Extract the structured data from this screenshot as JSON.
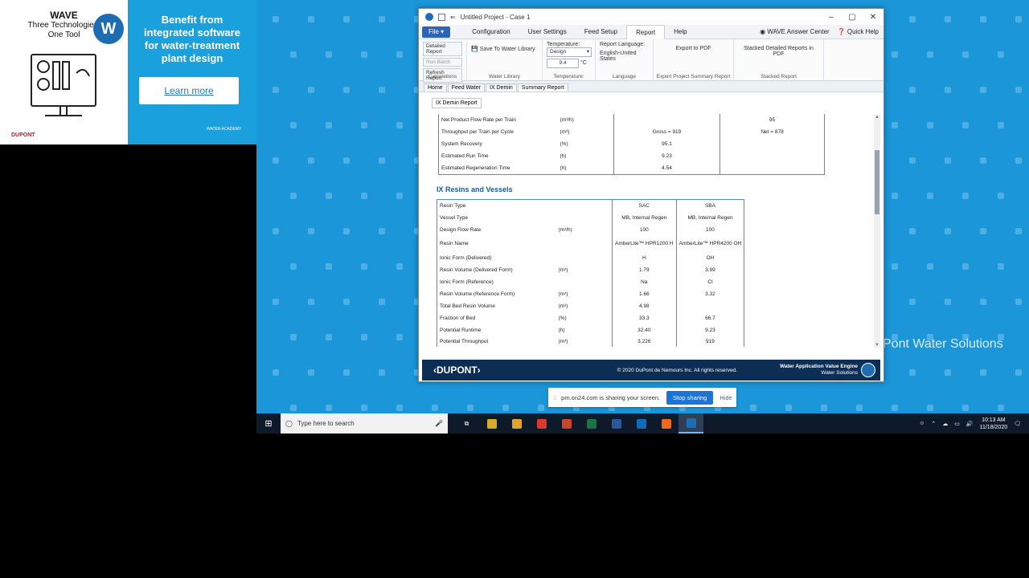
{
  "promo": {
    "product": "WAVE",
    "tagline_1": "Three Technologies,",
    "tagline_2": "One Tool",
    "logo_letter": "W",
    "brand": "DUPONT",
    "headline": "Benefit from integrated software for water-treatment plant design",
    "cta": "Learn more",
    "academy": "WATER ACADEMY"
  },
  "window": {
    "title": "Untitled Project - Case 1",
    "controls": [
      "–",
      "▢",
      "✕"
    ]
  },
  "menu": {
    "file": "File ▾",
    "items": [
      "Configuration",
      "User Settings",
      "Feed Setup",
      "Report",
      "Help"
    ],
    "active": "Report",
    "answer_center": "WAVE Answer Center",
    "quick_help": "Quick Help"
  },
  "ribbon": {
    "calc_buttons": [
      "Detailed Report",
      "Run Batch",
      "Refresh Report"
    ],
    "calc_caption": "Calculations",
    "save_water": "Save To Water Library",
    "water_caption": "Water Library",
    "temp_label": "Temperature:",
    "temp_select": "Design",
    "temp_value": "9.4",
    "temp_unit": "°C",
    "temp_caption": "Temperature:",
    "lang_label": "Report Language:",
    "lang_value": "English-United States",
    "lang_caption": "Language",
    "export_pdf": "Export to PDF",
    "export_caption": "Export Project Summary Report",
    "stacked": "Stacked Detailed Reports in PDF",
    "stacked_caption": "Stacked Report"
  },
  "tabs": [
    "Home",
    "Feed Water",
    "IX Demin",
    "Summary Report"
  ],
  "active_tab": "Summary Report",
  "subtab": "IX Demin Report",
  "summary_rows": [
    {
      "label": "Net Product Flow Rate per Train",
      "unit": "(m³/h)",
      "v1": "",
      "v2": "95"
    },
    {
      "label": "Throughput per Train per Cycle",
      "unit": "(m³)",
      "v1": "Gross = 919",
      "v2": "Net = 878"
    },
    {
      "label": "System Recovery",
      "unit": "(%)",
      "v1": "95.1",
      "v2": ""
    },
    {
      "label": "Estimated Run Time",
      "unit": "(h)",
      "v1": "9.23",
      "v2": ""
    },
    {
      "label": "Estimated Regeneration Time",
      "unit": "(h)",
      "v1": "4.54",
      "v2": ""
    }
  ],
  "section_title": "IX Resins and Vessels",
  "resin_rows": [
    {
      "label": "Resin Type",
      "unit": "",
      "a": "SAC",
      "b": "SBA"
    },
    {
      "label": "Vessel Type",
      "unit": "",
      "a": "MB, Internal Regen",
      "b": "MB, Internal Regen"
    },
    {
      "label": "Design Flow Rate",
      "unit": "(m³/h)",
      "a": "100",
      "b": "100"
    },
    {
      "label": "Resin Name",
      "unit": "",
      "a": "AmberLite™ HPR1200 H",
      "b": "AmberLite™ HPR4200 OH",
      "tall": true
    },
    {
      "label": "Ionic Form (Delivered)",
      "unit": "",
      "a": "H",
      "b": "OH"
    },
    {
      "label": "Resin Volume (Delivered Form)",
      "unit": "(m³)",
      "a": "1.79",
      "b": "3.99"
    },
    {
      "label": "Ionic Form (Reference)",
      "unit": "",
      "a": "Na",
      "b": "Cl"
    },
    {
      "label": "Resin Volume (Reference Form)",
      "unit": "(m³)",
      "a": "1.66",
      "b": "3.32"
    },
    {
      "label": "Total Bed Resin Volume",
      "unit": "(m³)",
      "a": "4.98",
      "b": ""
    },
    {
      "label": "Fraction of Bed",
      "unit": "(%)",
      "a": "33.3",
      "b": "66.7"
    },
    {
      "label": "Potential Runtime",
      "unit": "(h)",
      "a": "32.40",
      "b": "9.23"
    },
    {
      "label": "Potential Throughput",
      "unit": "(m³)",
      "a": "3,226",
      "b": "919"
    }
  ],
  "footer": {
    "brand": "‹DUPONT›",
    "copyright": "© 2020 DuPont de Nemours Inc. All rights reserved.",
    "engine": "Water Application Value Engine",
    "solutions": "Water Solutions"
  },
  "bg_text": "Pont Water Solutions",
  "share": {
    "message": "pm.on24.com is sharing your screen.",
    "stop": "Stop sharing",
    "hide": "Hide"
  },
  "taskbar": {
    "search_placeholder": "Type here to search",
    "time": "10:13 AM",
    "date": "11/18/2020",
    "app_colors": [
      "#d6ad29",
      "#e2a52b",
      "#d93a2b",
      "#c8472b",
      "#1e7145",
      "#2b579a",
      "#0f6cbd",
      "#f06a1d",
      "#1e6db3"
    ]
  }
}
